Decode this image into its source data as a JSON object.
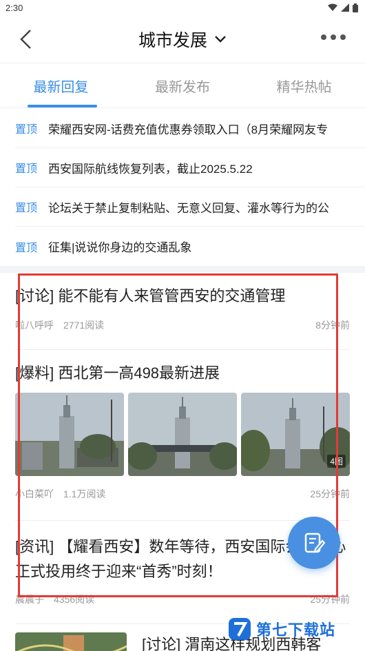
{
  "status_bar": {
    "time": "2:30"
  },
  "header": {
    "title": "城市发展"
  },
  "tabs": [
    {
      "label": "最新回复",
      "active": true
    },
    {
      "label": "最新发布",
      "active": false
    },
    {
      "label": "精华热帖",
      "active": false
    }
  ],
  "pinned": [
    {
      "tag": "置顶",
      "title": "荣耀西安网-话费充值优惠券领取入口（8月荣耀网友专"
    },
    {
      "tag": "置顶",
      "title": "西安国际航线恢复列表，截止2025.5.22"
    },
    {
      "tag": "置顶",
      "title": "论坛关于禁止复制粘贴、无意义回复、灌水等行为的公"
    },
    {
      "tag": "置顶",
      "title": "征集|说说你身边的交通乱象"
    }
  ],
  "posts": [
    {
      "title": "[讨论] 能不能有人来管管西安的交通管理",
      "author": "啦八呼呼",
      "reads": "2771阅读",
      "time": "8分钟前"
    },
    {
      "title": "[爆料] 西北第一高498最新进展",
      "author": "小白菜吖",
      "reads": "1.1万阅读",
      "time": "25分钟前",
      "image_count": "4图"
    },
    {
      "title": "[资讯] 【耀看西安】数年等待，西安国际会展中心正式投用终于迎来“首秀”时刻！",
      "author": "晨晨子",
      "reads": "4356阅读",
      "time": "25分钟前"
    }
  ],
  "last_post": {
    "title": "[讨论] 渭南这样规划西韩客"
  },
  "watermark": {
    "text": "第七下载站"
  },
  "colors": {
    "accent": "#3a8ee6",
    "highlight": "#e53935",
    "fab": "#4a90e2"
  }
}
